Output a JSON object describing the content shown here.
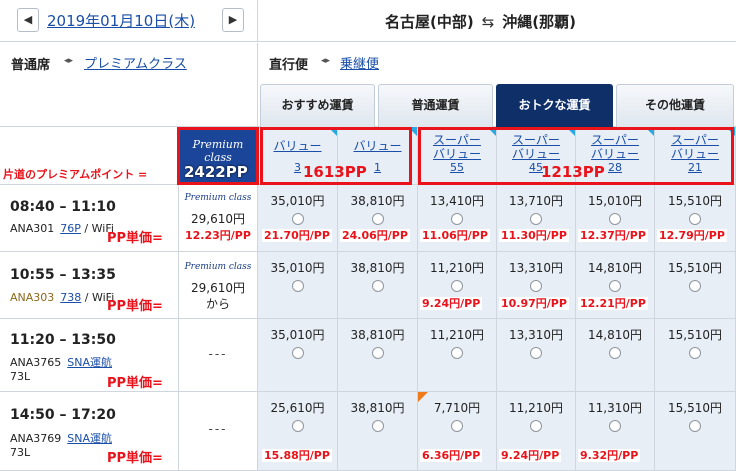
{
  "header": {
    "prev_icon": "◀",
    "next_icon": "▶",
    "date": "2019年01月10日(木)",
    "origin": "名古屋(中部)",
    "swap_icon": "⇆",
    "destination": "沖縄(那覇)"
  },
  "options": {
    "seat_label": "普通席",
    "seat_arrow": "◂▸",
    "seat_link": "プレミアムクラス",
    "route_label": "直行便",
    "route_arrow": "◂▸",
    "route_link": "乗継便"
  },
  "tabs": [
    {
      "label": "おすすめ運賃",
      "active": false
    },
    {
      "label": "普通運賃",
      "active": false
    },
    {
      "label": "おトクな運賃",
      "active": true
    },
    {
      "label": "その他運賃",
      "active": false
    }
  ],
  "premium_header": {
    "logo": "Premium class"
  },
  "fare_headers": [
    {
      "name": "バリュー",
      "num": "3"
    },
    {
      "name": "バリュー",
      "num": "1"
    },
    {
      "name": "スーパーバリュー",
      "num": "55"
    },
    {
      "name": "スーパーバリュー",
      "num": "45"
    },
    {
      "name": "スーパーバリュー",
      "num": "28"
    },
    {
      "name": "スーパーバリュー",
      "num": "21"
    }
  ],
  "flights": [
    {
      "time": "08:40 – 11:10",
      "flight_no": "ANA301",
      "aircraft_link": "76P",
      "extra": "/ WiFi",
      "aircraft": "",
      "premium_logo": "Premium class",
      "premium_price": "29,610円",
      "premium_suffix": "",
      "prices": [
        "35,010円",
        "38,810円",
        "13,410円",
        "13,710円",
        "15,010円",
        "15,510円"
      ],
      "pp_unit": [
        "12.23円/PP",
        "21.70円/PP",
        "24.06円/PP",
        "11.06円/PP",
        "11.30円/PP",
        "12.37円/PP",
        "12.79円/PP"
      ]
    },
    {
      "time": "10:55 – 13:35",
      "flight_no": "ANA303",
      "aircraft_link": "738",
      "extra": "/ WiFi",
      "aircraft": "",
      "premium_logo": "Premium class",
      "premium_price": "29,610円",
      "premium_suffix": "から",
      "prices": [
        "35,010円",
        "38,810円",
        "11,210円",
        "13,310円",
        "14,810円",
        "15,510円"
      ],
      "pp_unit": [
        "",
        "",
        "",
        "9.24円/PP",
        "10.97円/PP",
        "12.21円/PP",
        ""
      ]
    },
    {
      "time": "11:20 – 13:50",
      "flight_no": "ANA3765",
      "aircraft_link": "SNA運航",
      "extra": "",
      "aircraft": "73L",
      "premium_logo": "",
      "premium_price": "---",
      "premium_suffix": "",
      "prices": [
        "35,010円",
        "38,810円",
        "11,210円",
        "13,310円",
        "14,810円",
        "15,510円"
      ],
      "pp_unit": [
        "",
        "",
        "",
        "",
        "",
        "",
        ""
      ]
    },
    {
      "time": "14:50 – 17:20",
      "flight_no": "ANA3769",
      "aircraft_link": "SNA運航",
      "extra": "",
      "aircraft": "73L",
      "premium_logo": "",
      "premium_price": "---",
      "premium_suffix": "",
      "prices": [
        "25,610円",
        "38,810円",
        "7,710円",
        "11,210円",
        "11,310円",
        "15,510円"
      ],
      "pp_unit": [
        "",
        "15.88円/PP",
        "",
        "6.36円/PP",
        "9.24円/PP",
        "9.32円/PP",
        ""
      ]
    }
  ],
  "annotations": {
    "row_label": "片道のプレミアムポイント =",
    "premium_pp": "2422PP",
    "value_pp": "1613PP",
    "super_value_pp": "1213PP",
    "unit_label": "PP単価=",
    "colors": {
      "red": "#e8131b",
      "navy": "#0f2f69",
      "fare_bg": "#e7eef6",
      "link": "#1a4ea8"
    }
  }
}
